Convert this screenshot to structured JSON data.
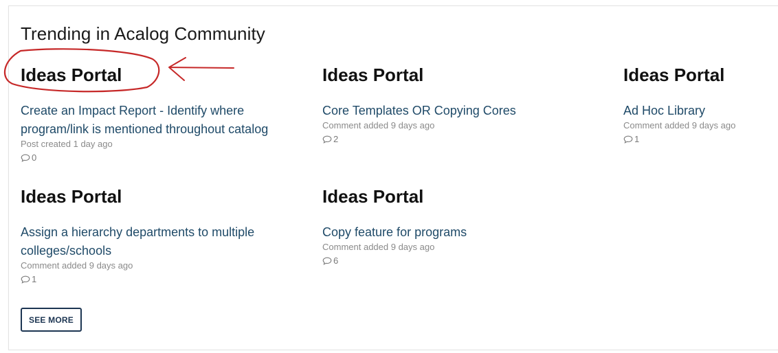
{
  "section_title": "Trending in Acalog Community",
  "cards": [
    {
      "category": "Ideas Portal",
      "link": "Create an Impact Report - Identify where program/link is mentioned throughout catalog",
      "meta": "Post created 1 day ago",
      "comments": "0"
    },
    {
      "category": "Ideas Portal",
      "link": "Core Templates OR Copying Cores",
      "meta": "Comment added 9 days ago",
      "comments": "2"
    },
    {
      "category": "Ideas Portal",
      "link": "Ad Hoc Library",
      "meta": "Comment added 9 days ago",
      "comments": "1"
    },
    {
      "category": "Ideas Portal",
      "link": "Assign a hierarchy departments to multiple colleges/schools",
      "meta": "Comment added 9 days ago",
      "comments": "1"
    },
    {
      "category": "Ideas Portal",
      "link": "Copy feature for programs",
      "meta": "Comment added 9 days ago",
      "comments": "6"
    }
  ],
  "see_more_label": "SEE MORE",
  "colors": {
    "link": "#1f4a68",
    "annotation": "#c62828",
    "button_border": "#1c3552"
  },
  "icons": {
    "comments": "speech-bubble-icon"
  }
}
